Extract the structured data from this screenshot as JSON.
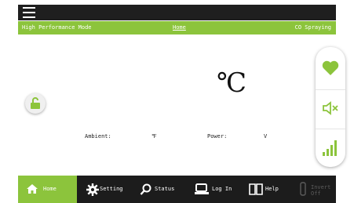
{
  "header": {
    "mode": "High Performance Mode",
    "page": "Home",
    "state": "CO Spraying"
  },
  "main": {
    "temperature_unit": "℃",
    "ambient_label": "Ambient:",
    "ambient_unit": "℉",
    "power_label": "Power:",
    "power_unit": "V"
  },
  "nav": {
    "home": "Home",
    "setting": "Setting",
    "status": "Status",
    "login": "Log In",
    "help": "Help",
    "invert": "Invert Off"
  },
  "colors": {
    "accent": "#8cc43c",
    "bar": "#1c1c1c"
  }
}
